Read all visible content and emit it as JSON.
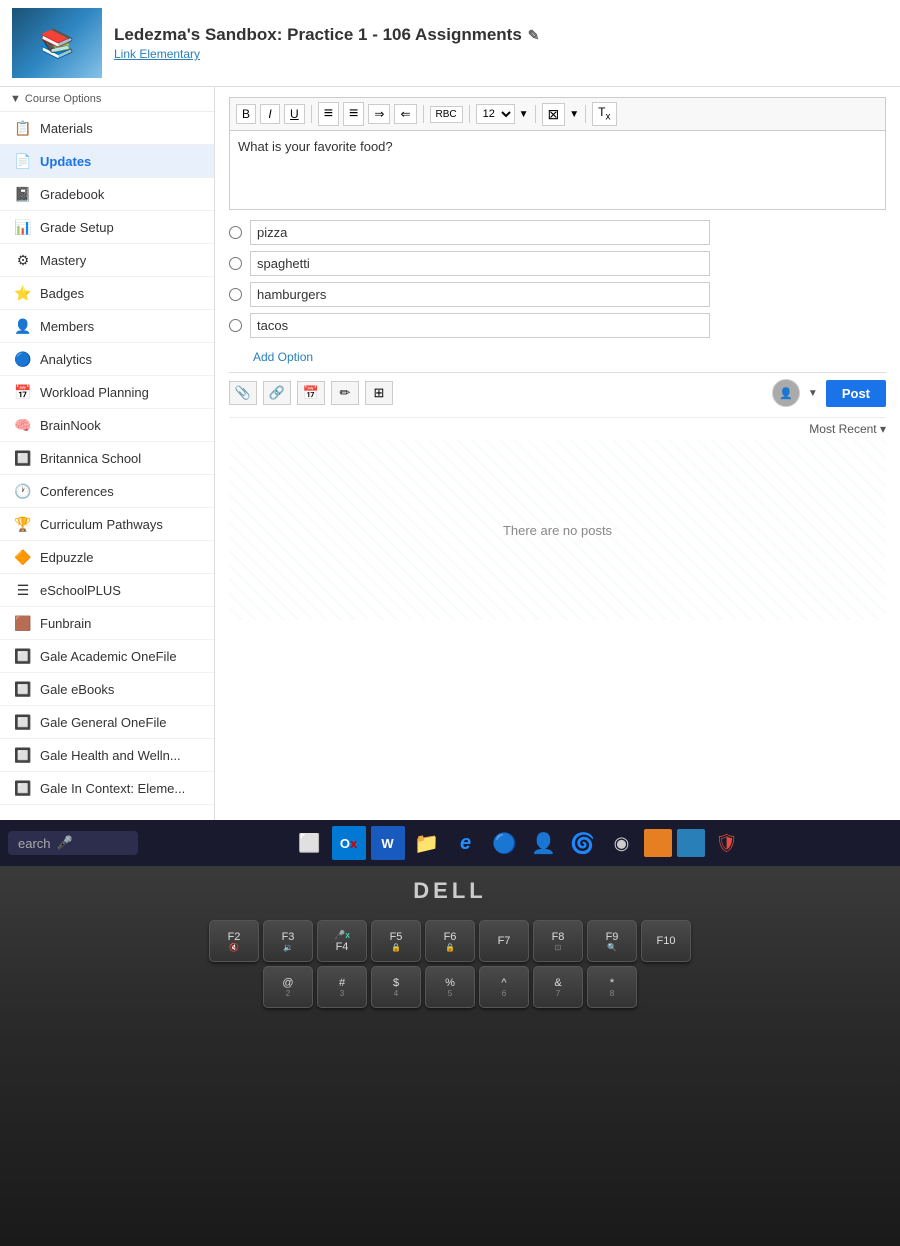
{
  "header": {
    "title": "Ledezma's Sandbox: Practice 1 - 106 Assignments",
    "subtitle": "Link Elementary",
    "edit_icon": "✎"
  },
  "sidebar": {
    "course_options_label": "Course Options",
    "items": [
      {
        "id": "materials",
        "label": "Materials",
        "icon": "📋"
      },
      {
        "id": "updates",
        "label": "Updates",
        "icon": "📄",
        "active": true
      },
      {
        "id": "gradebook",
        "label": "Gradebook",
        "icon": "📓"
      },
      {
        "id": "grade-setup",
        "label": "Grade Setup",
        "icon": "📊"
      },
      {
        "id": "mastery",
        "label": "Mastery",
        "icon": "⚙"
      },
      {
        "id": "badges",
        "label": "Badges",
        "icon": "⭐"
      },
      {
        "id": "members",
        "label": "Members",
        "icon": "👤"
      },
      {
        "id": "analytics",
        "label": "Analytics",
        "icon": "🔵"
      },
      {
        "id": "workload-planning",
        "label": "Workload Planning",
        "icon": "📅"
      },
      {
        "id": "brainnook",
        "label": "BrainNook",
        "icon": "🧠"
      },
      {
        "id": "britannica",
        "label": "Britannica School",
        "icon": "🔲"
      },
      {
        "id": "conferences",
        "label": "Conferences",
        "icon": "🕐"
      },
      {
        "id": "curriculum-pathways",
        "label": "Curriculum Pathways",
        "icon": "🏆"
      },
      {
        "id": "edpuzzle",
        "label": "Edpuzzle",
        "icon": "🔶"
      },
      {
        "id": "eschoolplus",
        "label": "eSchoolPLUS",
        "icon": "☰"
      },
      {
        "id": "funbrain",
        "label": "Funbrain",
        "icon": "🟫"
      },
      {
        "id": "gale-academic",
        "label": "Gale Academic OneFile",
        "icon": "🔲"
      },
      {
        "id": "gale-ebooks",
        "label": "Gale eBooks",
        "icon": "🔲"
      },
      {
        "id": "gale-general",
        "label": "Gale General OneFile",
        "icon": "🔲"
      },
      {
        "id": "gale-health",
        "label": "Gale Health and Welln...",
        "icon": "🔲"
      },
      {
        "id": "gale-context",
        "label": "Gale In Context: Eleme...",
        "icon": "🔲"
      }
    ]
  },
  "editor": {
    "toolbar": {
      "bold": "B",
      "italic": "I",
      "underline": "U",
      "ul": "≡",
      "ol": "≡",
      "indent": "⇒",
      "outdent": "⇐",
      "spell": "RBC",
      "font_size": "12",
      "image": "⊠",
      "clear": "Tx"
    },
    "question": "What is your favorite food?",
    "poll_options": [
      {
        "id": "opt1",
        "value": "pizza"
      },
      {
        "id": "opt2",
        "value": "spaghetti"
      },
      {
        "id": "opt3",
        "value": "hamburgers"
      },
      {
        "id": "opt4",
        "value": "tacos"
      }
    ],
    "add_option_label": "Add Option",
    "post_label": "Post",
    "most_recent_label": "Most Recent ▾",
    "no_posts_label": "There are no posts"
  },
  "taskbar": {
    "search_placeholder": "earch",
    "mic_icon": "🎤",
    "task_view_icon": "⬜",
    "outlook_icon": "Ox",
    "word_icon": "W",
    "files_icon": "📁",
    "edge_icon": "e",
    "chrome_icon": "◎",
    "avatar_icon": "👤",
    "spiral_icon": "🌀",
    "toggle_icon": "◉",
    "orange_icon": "🟠",
    "blue_icon": "🔵",
    "shield_icon": "🛡"
  },
  "keyboard": {
    "row1": [
      "F2",
      "F3",
      "F4",
      "F5",
      "F6",
      "F7",
      "F8",
      "F9",
      "F10"
    ],
    "row2": [
      "@",
      "#",
      "$",
      "%",
      "^",
      "&",
      "*"
    ]
  },
  "colors": {
    "accent_blue": "#1a73e8",
    "sidebar_active": "#e8f0fb",
    "post_btn": "#1a73e8"
  }
}
